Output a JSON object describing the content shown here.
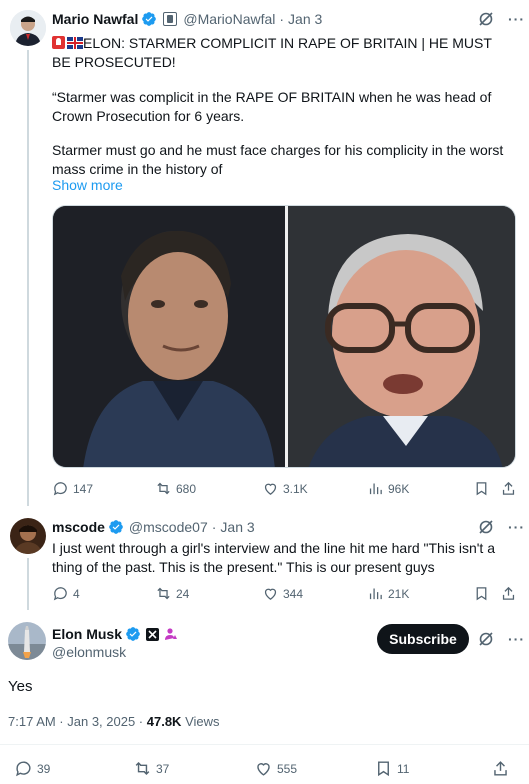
{
  "tweet1": {
    "name": "Mario Nawfal",
    "handle": "@MarioNawfal",
    "date": "Jan 3",
    "headline": "ELON: STARMER COMPLICIT IN RAPE OF BRITAIN | HE MUST BE PROSECUTED!",
    "para1": "“Starmer was complicit in the RAPE OF BRITAIN when he was head of Crown Prosecution for 6 years.",
    "para2": "Starmer must go and he must face charges for his complicity in the worst mass crime in the history of",
    "show_more": "Show more",
    "replies": "147",
    "reposts": "680",
    "likes": "3.1K",
    "views": "96K"
  },
  "tweet2": {
    "name": "mscode",
    "handle": "@mscode07",
    "date": "Jan 3",
    "text": "I just went through a girl's interview and the line hit me hard \"This isn't a thing of the past. This is the present.\" This is our present guys",
    "replies": "4",
    "reposts": "24",
    "likes": "344",
    "views": "21K"
  },
  "tweet3": {
    "name": "Elon Musk",
    "handle": "@elonmusk",
    "subscribe_label": "Subscribe",
    "text": "Yes",
    "time": "7:17 AM · Jan 3, 2025 · ",
    "views_count": "47.8K",
    "views_label": " Views",
    "replies": "39",
    "reposts": "37",
    "likes": "555",
    "bookmarks": "11"
  },
  "colors": {
    "accent": "#1d9bf0",
    "muted": "#536471",
    "text": "#0f1419"
  }
}
